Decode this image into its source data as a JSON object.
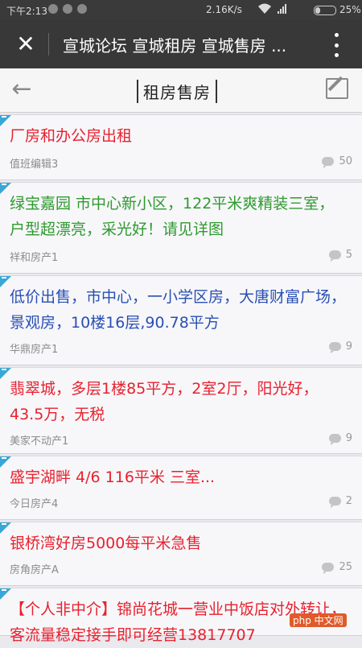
{
  "status_bar": {
    "time": "下午2:13",
    "speed": "2.16K/s",
    "battery": "25%",
    "battery_level": 0.25
  },
  "titlebar": {
    "title": "宣城论坛 宣城租房 宣城售房 ..."
  },
  "nav": {
    "page_title": "租房售房"
  },
  "posts": [
    {
      "title": "厂房和办公房出租",
      "author": "值班编辑3",
      "comments": "50",
      "color": "#e8212e"
    },
    {
      "title": "绿宝嘉园 市中心新小区，122平米爽精装三室，户型超漂亮，采光好！请见详图",
      "author": "祥和房产1",
      "comments": "5",
      "color": "#2f9a2f"
    },
    {
      "title": "低价出售，市中心，一小学区房，大唐财富广场，景观房，10楼16层,90.78平方",
      "author": "华鼎房产1",
      "comments": "9",
      "color": "#2a4fb3"
    },
    {
      "title": "翡翠城，多层1楼85平方，2室2厅，阳光好，43.5万，无税",
      "author": "美家不动产1",
      "comments": "9",
      "color": "#e8212e"
    },
    {
      "title": "盛宇湖畔 4/6 116平米 三室...",
      "author": "今日房产4",
      "comments": "2",
      "color": "#e8212e"
    },
    {
      "title": "银桥湾好房5000每平米急售",
      "author": "房角房产A",
      "comments": "25",
      "color": "#e8212e"
    },
    {
      "title": "【个人非中介】锦尚花城一营业中饭店对外转让，客流量稳定接手即可经营13817707",
      "author": "",
      "comments": "",
      "color": "#e8212e"
    }
  ],
  "watermark": "php 中文网"
}
